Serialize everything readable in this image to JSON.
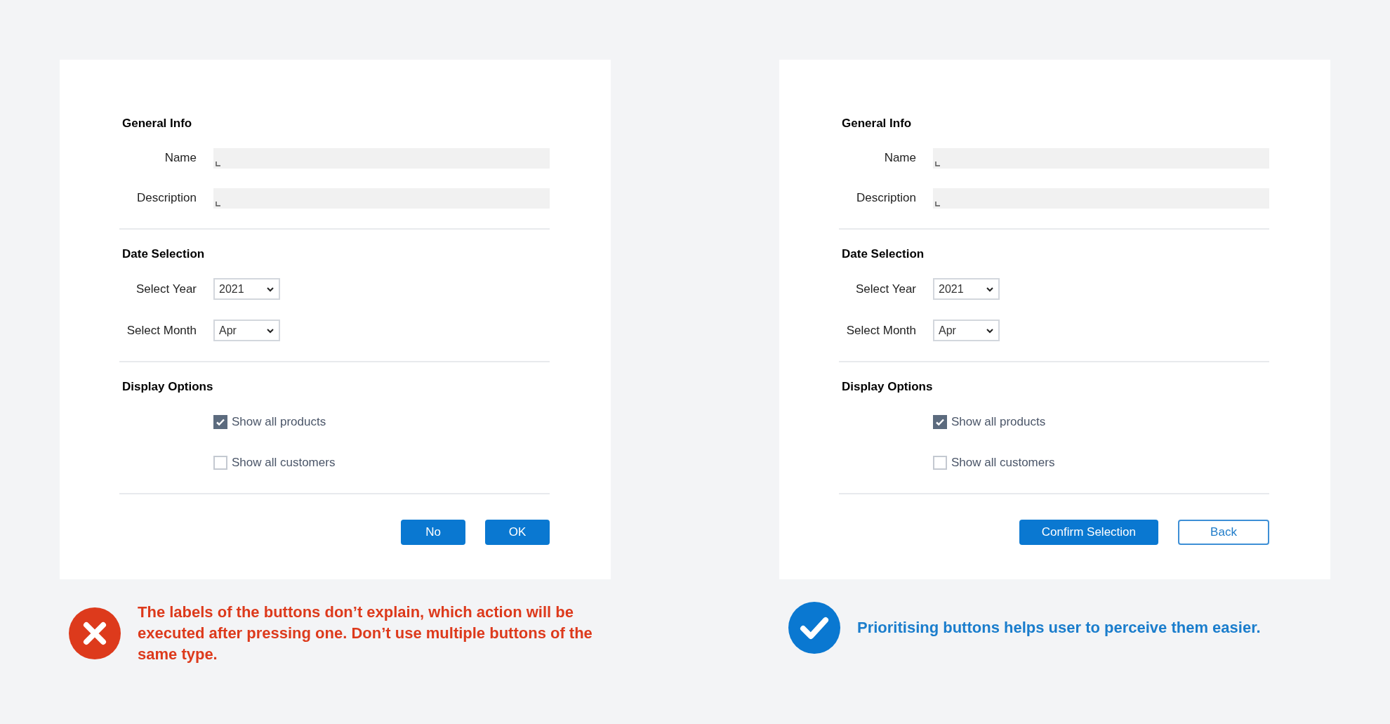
{
  "panels": [
    {
      "sections": [
        {
          "heading": "General Info",
          "rows": [
            {
              "kind": "text",
              "label": "Name"
            },
            {
              "kind": "text",
              "label": "Description"
            }
          ]
        },
        {
          "heading": "Date Selection",
          "rows": [
            {
              "kind": "select",
              "label": "Select Year",
              "value": "2021"
            },
            {
              "kind": "select",
              "label": "Select Month",
              "value": "Apr"
            }
          ]
        },
        {
          "heading": "Display Options",
          "rows": [
            {
              "kind": "checkbox",
              "label": "Show all products",
              "checked": true
            },
            {
              "kind": "checkbox",
              "label": "Show all customers",
              "checked": false
            }
          ]
        }
      ],
      "buttons": [
        {
          "label": "No",
          "kind": "primary"
        },
        {
          "label": "OK",
          "kind": "primary"
        }
      ],
      "verdict": {
        "kind": "bad",
        "text": "The labels of the buttons don’t explain, which action will be executed after pressing one. Don’t use multiple buttons of the same type."
      }
    },
    {
      "sections": [
        {
          "heading": "General Info",
          "rows": [
            {
              "kind": "text",
              "label": "Name"
            },
            {
              "kind": "text",
              "label": "Description"
            }
          ]
        },
        {
          "heading": "Date Selection",
          "rows": [
            {
              "kind": "select",
              "label": "Select Year",
              "value": "2021"
            },
            {
              "kind": "select",
              "label": "Select Month",
              "value": "Apr"
            }
          ]
        },
        {
          "heading": "Display Options",
          "rows": [
            {
              "kind": "checkbox",
              "label": "Show all products",
              "checked": true
            },
            {
              "kind": "checkbox",
              "label": "Show all customers",
              "checked": false
            }
          ]
        }
      ],
      "buttons": [
        {
          "label": "Confirm Selection",
          "kind": "primary"
        },
        {
          "label": "Back",
          "kind": "secondary"
        }
      ],
      "verdict": {
        "kind": "good",
        "text": "Prioritising buttons helps user to perceive them easier."
      }
    }
  ]
}
